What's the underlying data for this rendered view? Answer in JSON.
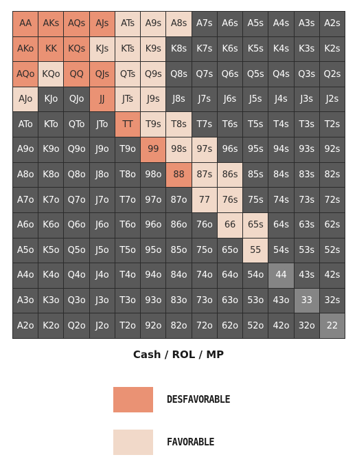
{
  "chart_data": {
    "type": "heatmap",
    "title": "Cash / ROL / MP",
    "grid": [
      [
        "AA",
        "AKs",
        "AQs",
        "AJs",
        "ATs",
        "A9s",
        "A8s",
        "A7s",
        "A6s",
        "A5s",
        "A4s",
        "A3s",
        "A2s"
      ],
      [
        "AKo",
        "KK",
        "KQs",
        "KJs",
        "KTs",
        "K9s",
        "K8s",
        "K7s",
        "K6s",
        "K5s",
        "K4s",
        "K3s",
        "K2s"
      ],
      [
        "AQo",
        "KQo",
        "QQ",
        "QJs",
        "QTs",
        "Q9s",
        "Q8s",
        "Q7s",
        "Q6s",
        "Q5s",
        "Q4s",
        "Q3s",
        "Q2s"
      ],
      [
        "AJo",
        "KJo",
        "QJo",
        "JJ",
        "JTs",
        "J9s",
        "J8s",
        "J7s",
        "J6s",
        "J5s",
        "J4s",
        "J3s",
        "J2s"
      ],
      [
        "ATo",
        "KTo",
        "QTo",
        "JTo",
        "TT",
        "T9s",
        "T8s",
        "T7s",
        "T6s",
        "T5s",
        "T4s",
        "T3s",
        "T2s"
      ],
      [
        "A9o",
        "K9o",
        "Q9o",
        "J9o",
        "T9o",
        "99",
        "98s",
        "97s",
        "96s",
        "95s",
        "94s",
        "93s",
        "92s"
      ],
      [
        "A8o",
        "K8o",
        "Q8o",
        "J8o",
        "T8o",
        "98o",
        "88",
        "87s",
        "86s",
        "85s",
        "84s",
        "83s",
        "82s"
      ],
      [
        "A7o",
        "K7o",
        "Q7o",
        "J7o",
        "T7o",
        "97o",
        "87o",
        "77",
        "76s",
        "75s",
        "74s",
        "73s",
        "72s"
      ],
      [
        "A6o",
        "K6o",
        "Q6o",
        "J6o",
        "T6o",
        "96o",
        "86o",
        "76o",
        "66",
        "65s",
        "64s",
        "63s",
        "62s"
      ],
      [
        "A5o",
        "K5o",
        "Q5o",
        "J5o",
        "T5o",
        "95o",
        "85o",
        "75o",
        "65o",
        "55",
        "54s",
        "53s",
        "52s"
      ],
      [
        "A4o",
        "K4o",
        "Q4o",
        "J4o",
        "T4o",
        "94o",
        "84o",
        "74o",
        "64o",
        "54o",
        "44",
        "43s",
        "42s"
      ],
      [
        "A3o",
        "K3o",
        "Q3o",
        "J3o",
        "T3o",
        "93o",
        "83o",
        "73o",
        "63o",
        "53o",
        "43o",
        "33",
        "32s"
      ],
      [
        "A2o",
        "K2o",
        "Q2o",
        "J2o",
        "T2o",
        "92o",
        "82o",
        "72o",
        "62o",
        "52o",
        "42o",
        "32o",
        "22"
      ]
    ],
    "categories": {
      "desfavorable": [
        "AA",
        "AKs",
        "AQs",
        "AJs",
        "AKo",
        "KK",
        "KQs",
        "AQo",
        "QQ",
        "QJs",
        "JJ",
        "TT",
        "99",
        "88"
      ],
      "favorable": [
        "ATs",
        "A9s",
        "A8s",
        "KJs",
        "KTs",
        "K9s",
        "KQo",
        "QTs",
        "Q9s",
        "AJo",
        "JTs",
        "J9s",
        "T9s",
        "T8s",
        "98s",
        "97s",
        "87s",
        "86s",
        "77",
        "76s",
        "66",
        "65s",
        "55"
      ],
      "pair_gray": [
        "44",
        "33",
        "22"
      ]
    },
    "legend": [
      {
        "label": "DESFAVORABLE",
        "color": "#ea9274"
      },
      {
        "label": "FAVORABLE",
        "color": "#f1d9c9"
      }
    ],
    "colors": {
      "desfavorable": "#ea9274",
      "favorable": "#f1d9c9",
      "neutral": "#595959",
      "pair_gray": "#858585",
      "grid_line": "#2b2b2b"
    }
  }
}
